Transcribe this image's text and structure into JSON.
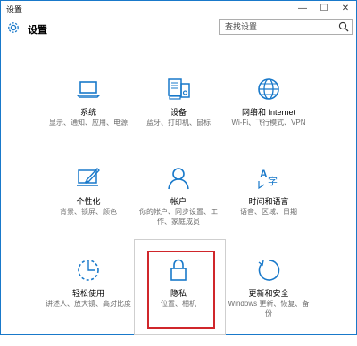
{
  "window": {
    "title": "设置",
    "controls": {
      "minimize": "—",
      "maximize": "☐",
      "close": "✕"
    }
  },
  "header": {
    "app_title": "设置",
    "icon": "gear-icon"
  },
  "search": {
    "placeholder": "查找设置",
    "icon": "search-icon"
  },
  "accent_color": "#1979ca",
  "highlight_color": "#d0262b",
  "tiles": [
    {
      "name": "系统",
      "desc": "显示、通知、应用、电源",
      "icon": "laptop-icon"
    },
    {
      "name": "设备",
      "desc": "蓝牙、打印机、鼠标",
      "icon": "devices-icon"
    },
    {
      "name": "网络和 Internet",
      "desc": "Wi-Fi、飞行模式、VPN",
      "icon": "globe-icon"
    },
    {
      "name": "个性化",
      "desc": "背景、锁屏、颜色",
      "icon": "paint-icon"
    },
    {
      "name": "帐户",
      "desc": "你的帐户、同步设置、工作、家庭成员",
      "icon": "person-icon"
    },
    {
      "name": "时间和语言",
      "desc": "语音、区域、日期",
      "icon": "time-language-icon"
    },
    {
      "name": "轻松使用",
      "desc": "讲述人、放大镜、高对比度",
      "icon": "ease-of-access-icon"
    },
    {
      "name": "隐私",
      "desc": "位置、相机",
      "icon": "lock-icon",
      "selected": true
    },
    {
      "name": "更新和安全",
      "desc": "Windows 更新、恢复、备份",
      "icon": "update-icon"
    }
  ]
}
